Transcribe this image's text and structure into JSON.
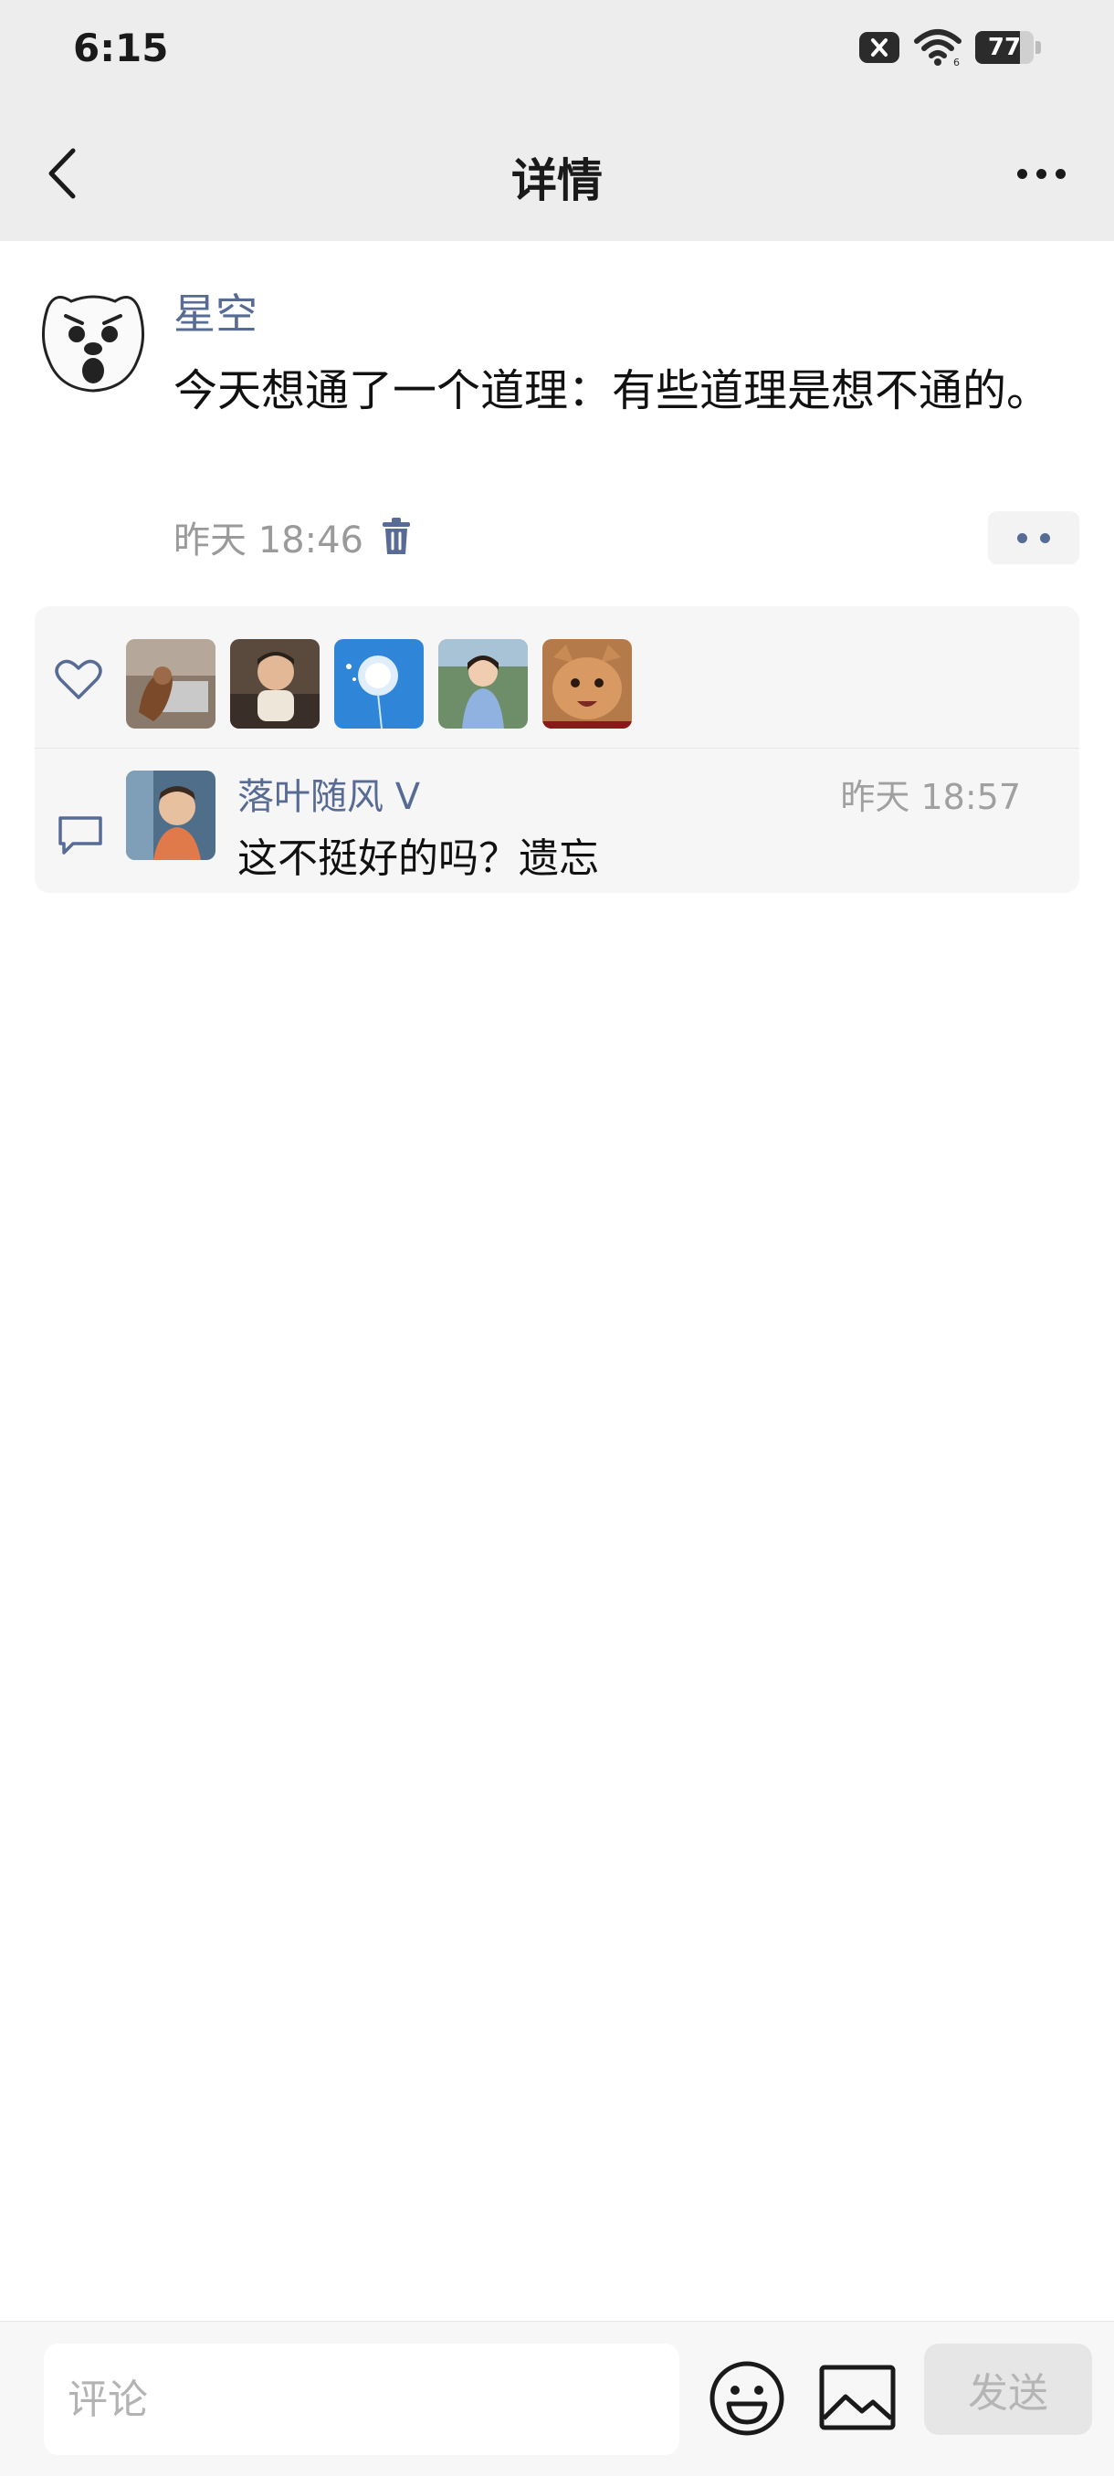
{
  "status_bar": {
    "time": "6:15",
    "battery_level": "77",
    "battery_fraction": 0.77,
    "icons": [
      "notification-x-icon",
      "wifi-icon",
      "battery-icon"
    ]
  },
  "header": {
    "title": "详情",
    "back_icon": "chevron-left-icon",
    "more_icon": "more-dots-icon"
  },
  "post": {
    "author": "星空",
    "content": "今天想通了一个道理：有些道理是想不通的。",
    "time": "昨天 18:46",
    "delete_icon": "trash-icon",
    "action_icon": "two-dots-icon"
  },
  "likes": {
    "icon": "heart-icon",
    "avatars": [
      "liker-avatar-1",
      "liker-avatar-2",
      "liker-avatar-3",
      "liker-avatar-4",
      "liker-avatar-5"
    ]
  },
  "comments": [
    {
      "author": "落叶随风 V",
      "time": "昨天 18:57",
      "text": "这不挺好的吗？遗忘"
    }
  ],
  "bottom_bar": {
    "placeholder": "评论",
    "send_label": "发送",
    "emoji_icon": "emoji-icon",
    "image_icon": "image-icon"
  },
  "colors": {
    "link_blue": "#576b95",
    "header_bg": "#ededed",
    "panel_bg": "#f6f6f6"
  }
}
